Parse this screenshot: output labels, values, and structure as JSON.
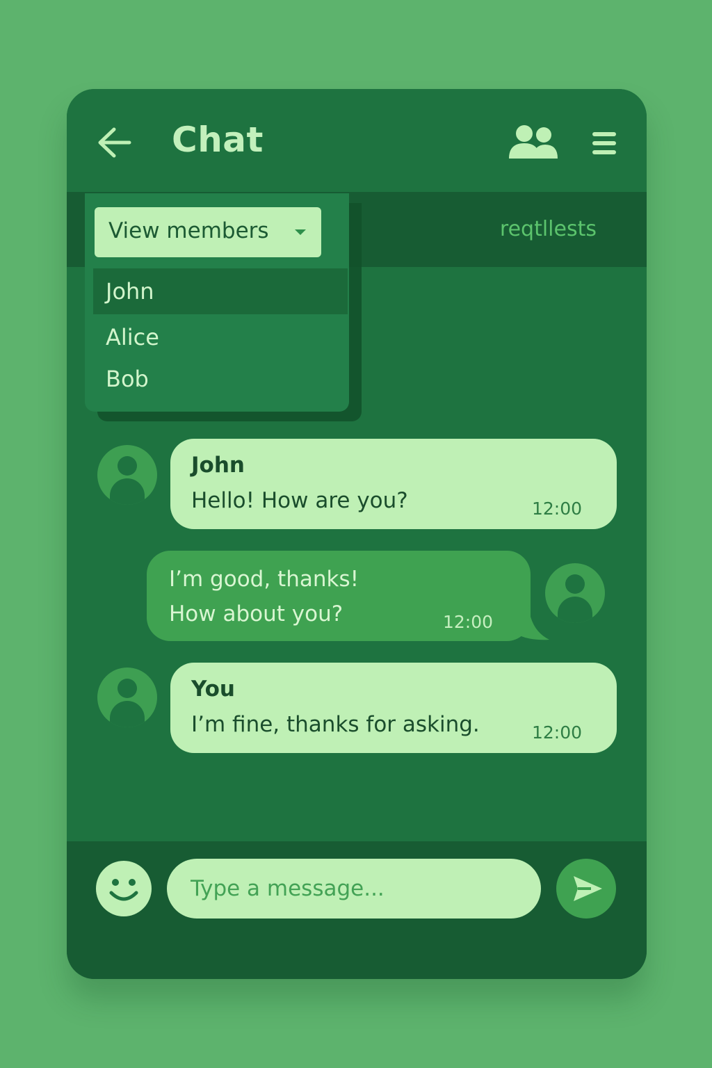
{
  "header": {
    "title": "Chat",
    "back_icon": "arrow-left-icon",
    "members_icon": "group-icon",
    "menu_icon": "hamburger-menu-icon"
  },
  "subbar": {
    "requests_label": "reqtllests"
  },
  "dropdown": {
    "label": "View members",
    "members": [
      "John",
      "Alice",
      "Bob"
    ],
    "selected": "John"
  },
  "messages": [
    {
      "sender": "John",
      "text": "Hello! How are you?",
      "time": "12:00",
      "side": "left"
    },
    {
      "sender": "",
      "text_line1": "I’m good, thanks!",
      "text_line2": "How about you?",
      "time": "12:00",
      "side": "right"
    },
    {
      "sender": "You",
      "text": "I’m fine, thanks for asking.",
      "time": "12:00",
      "side": "left"
    }
  ],
  "composer": {
    "placeholder": "Type a message...",
    "emoji_icon": "smiley-icon",
    "send_icon": "send-icon"
  },
  "colors": {
    "background": "#5db36d",
    "card": "#1e7340",
    "bar": "#175c33",
    "light_bubble": "#bff0b5",
    "accent": "#3fa251",
    "text_light": "#c3f0bc"
  }
}
